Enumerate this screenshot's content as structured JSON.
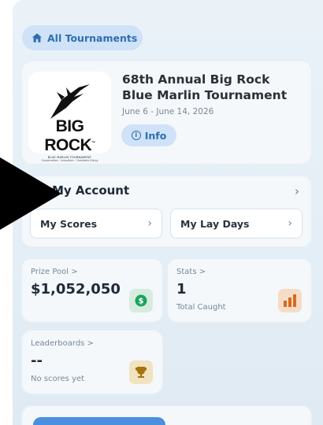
{
  "nav": {
    "all_tournaments_label": "All Tournaments"
  },
  "tournament": {
    "logo_big_text": "BIG ROCK",
    "logo_tm": "™",
    "logo_subtitle": "BLUE MARLIN TOURNAMENT",
    "logo_tagline": "Conservation · Innovation · Charitable Giving",
    "title": "68th Annual Big Rock Blue Marlin Tournament",
    "dates": "June 6 - June 14, 2026",
    "info_label": "Info"
  },
  "account": {
    "title": "My Account",
    "buttons": [
      {
        "label": "My Scores"
      },
      {
        "label": "My Lay Days"
      }
    ]
  },
  "stats": {
    "prize_pool": {
      "label": "Prize Pool >",
      "value": "$1,052,050",
      "icon": "dollar-icon",
      "color": "#1aa45f"
    },
    "caught": {
      "label": "Stats >",
      "value": "1",
      "sub": "Total Caught",
      "icon": "bar-chart-icon",
      "color": "#d9691f"
    },
    "leaderboards": {
      "label": "Leaderboards >",
      "value": "--",
      "sub": "No scores yet",
      "icon": "trophy-icon",
      "color": "#a6730c"
    }
  },
  "colors": {
    "accent": "#2f6fb0",
    "pill_bg": "#cfe2f7"
  }
}
